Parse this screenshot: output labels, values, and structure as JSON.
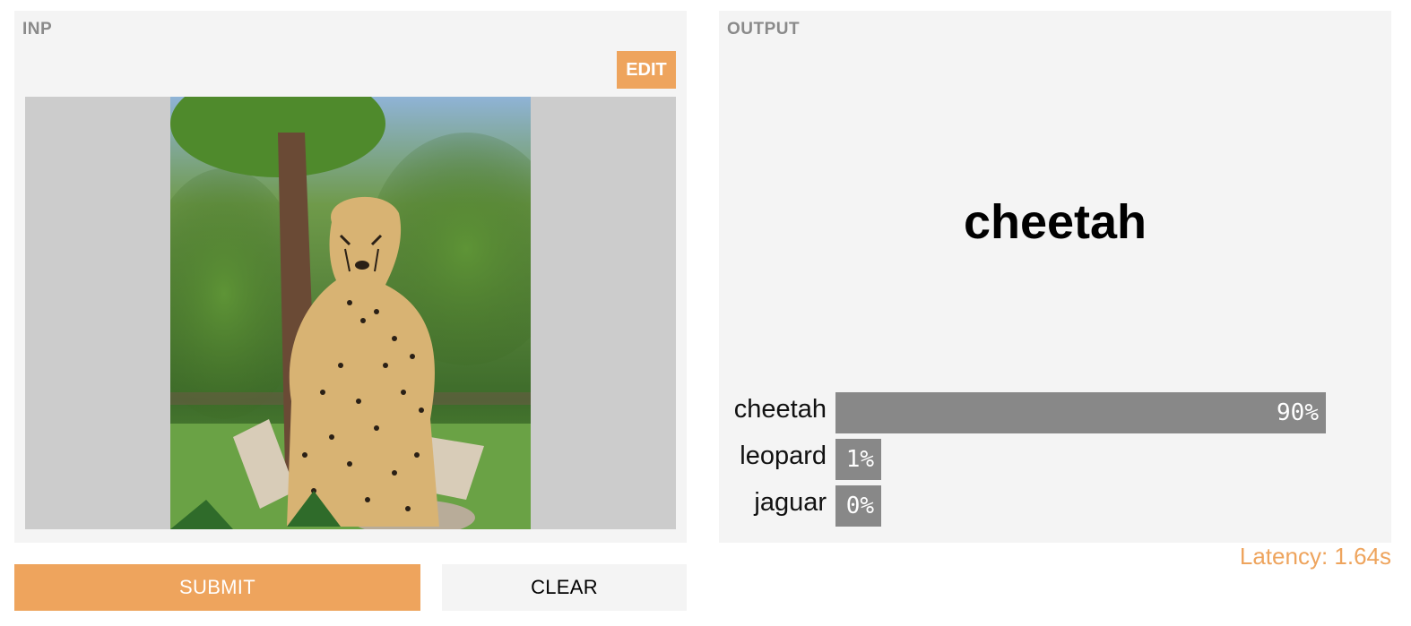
{
  "input": {
    "label": "INP",
    "edit_label": "EDIT"
  },
  "output": {
    "label": "OUTPUT",
    "predicted_label": "cheetah",
    "confidences": [
      {
        "label": "cheetah",
        "value": 0.9,
        "text": "90%"
      },
      {
        "label": "leopard",
        "value": 0.01,
        "text": "1%"
      },
      {
        "label": "jaguar",
        "value": 0.0,
        "text": "0%"
      }
    ]
  },
  "latency": "Latency: 1.64s",
  "buttons": {
    "submit": "SUBMIT",
    "clear": "CLEAR"
  },
  "colors": {
    "accent": "#eea45d",
    "panel_bg": "#f4f4f4",
    "bar": "#888888",
    "image_bg": "#cccccc"
  }
}
